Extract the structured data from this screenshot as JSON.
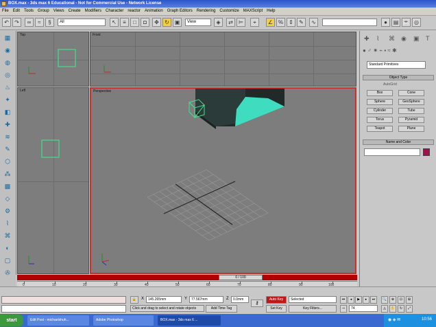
{
  "window": {
    "title": "BOX.max - 3ds max 6 Educational - Not for Commercial Use - Network License"
  },
  "menu": [
    "File",
    "Edit",
    "Tools",
    "Group",
    "Views",
    "Create",
    "Modifiers",
    "Character",
    "reactor",
    "Animation",
    "Graph Editors",
    "Rendering",
    "Customize",
    "MAXScript",
    "Help"
  ],
  "toolbar": {
    "selection_filter": "All",
    "coord_system": "View"
  },
  "viewports": {
    "top": "Top",
    "front": "Front",
    "left": "Left",
    "perspective": "Perspective"
  },
  "right_panel": {
    "category_dropdown": "Standard Primitives",
    "object_type_header": "Object Type",
    "autogrid_label": "AutoGrid",
    "buttons": [
      "Box",
      "Cone",
      "Sphere",
      "GeoSphere",
      "Cylinder",
      "Tube",
      "Torus",
      "Pyramid",
      "Teapot",
      "Plane"
    ],
    "name_color_header": "Name and Color",
    "color_swatch": "#a0104a"
  },
  "timeline": {
    "slider_label": "0 / 100",
    "ticks": [
      "0",
      "10",
      "20",
      "30",
      "40",
      "50",
      "60",
      "70",
      "80",
      "90",
      "100"
    ]
  },
  "status": {
    "prompt": "Click and drag to select and rotate objects",
    "add_time_tag": "Add Time Tag",
    "x_value": "145.265mm",
    "y_value": "77.567mm",
    "z_value": "0.0mm",
    "auto_key": "Auto Key",
    "set_key": "Set Key",
    "key_mode": "Selected",
    "key_filters": "Key Filters...",
    "frame": "74"
  },
  "taskbar": {
    "start": "start",
    "tasks": [
      "Edit Post - michaelshuh...",
      "Adobe Photoshop",
      "BOX.max - 3ds max 6 ..."
    ],
    "clock": "10:56"
  },
  "colors": {
    "accent": "#f0d040",
    "timeline_red": "#b00000",
    "selection_green": "#40e090",
    "box_cyan": "#40e0c0"
  }
}
